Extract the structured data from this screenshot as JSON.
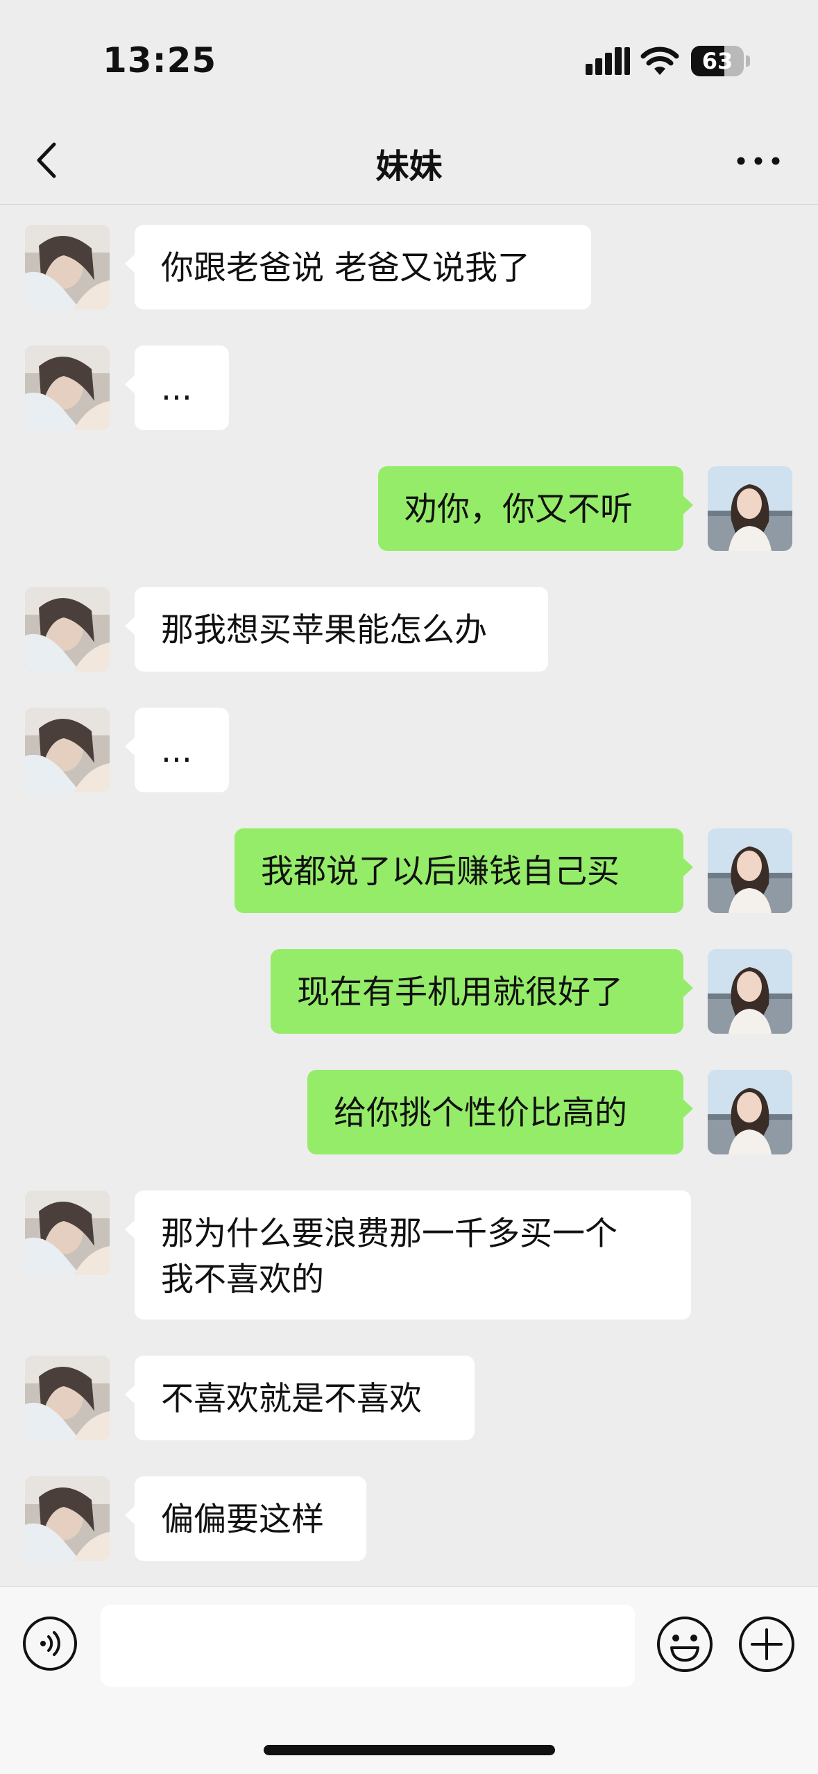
{
  "status_bar": {
    "time": "13:25",
    "battery": "63",
    "battery_level": 0.63
  },
  "header": {
    "title": "妹妹"
  },
  "messages": [
    {
      "side": "left",
      "text": "你跟老爸说 老爸又说我了"
    },
    {
      "side": "left",
      "text": "..."
    },
    {
      "side": "right",
      "text": "劝你，你又不听"
    },
    {
      "side": "left",
      "text": "那我想买苹果能怎么办"
    },
    {
      "side": "left",
      "text": "..."
    },
    {
      "side": "right",
      "text": "我都说了以后赚钱自己买"
    },
    {
      "side": "right",
      "text": "现在有手机用就很好了"
    },
    {
      "side": "right",
      "text": "给你挑个性价比高的"
    },
    {
      "side": "left",
      "text": "那为什么要浪费那一千多买一个\n我不喜欢的"
    },
    {
      "side": "left",
      "text": "不喜欢就是不喜欢"
    },
    {
      "side": "left",
      "text": "偏偏要这样"
    }
  ],
  "input": {
    "value": "",
    "placeholder": ""
  },
  "colors": {
    "background": "#ededed",
    "bubble_left": "#ffffff",
    "bubble_right": "#95ec69"
  },
  "icons": {
    "back": "chevron-left-icon",
    "more": "more-dots-icon",
    "voice": "voice-icon",
    "emoji": "emoji-icon",
    "plus": "plus-icon"
  }
}
